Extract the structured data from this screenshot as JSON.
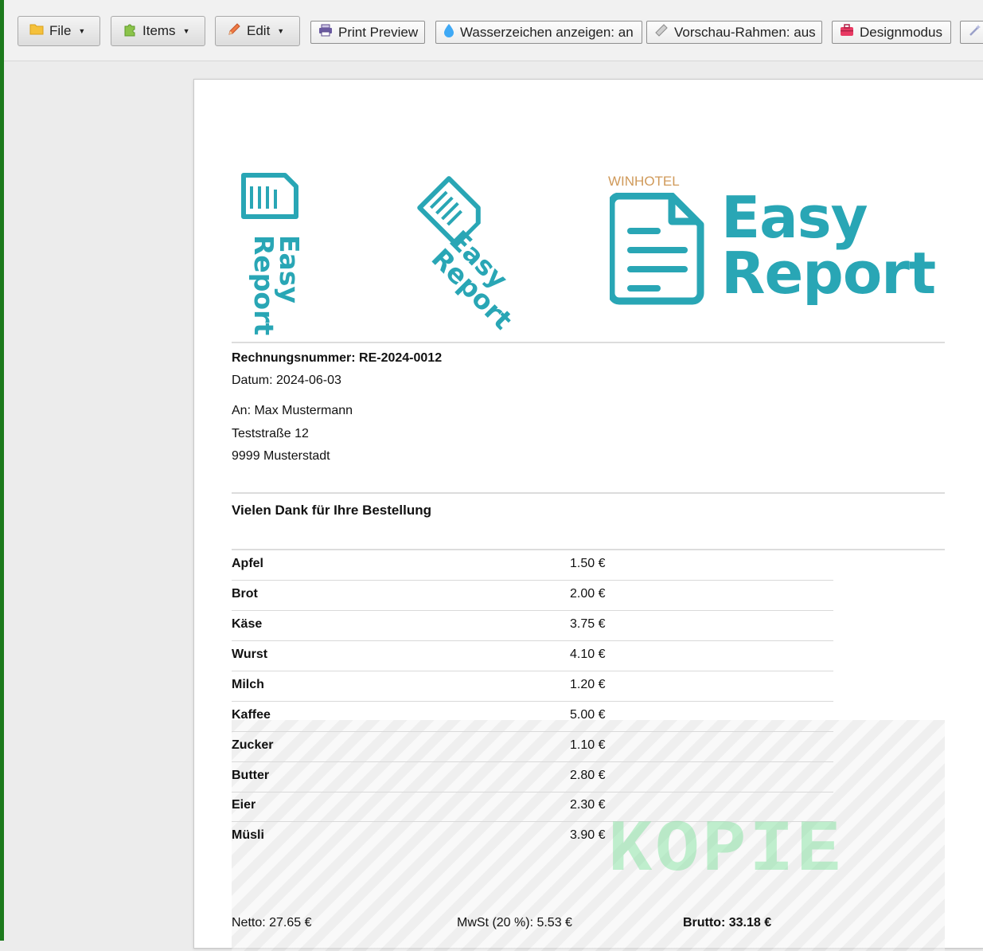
{
  "toolbar": {
    "file_label": "File",
    "items_label": "Items",
    "edit_label": "Edit",
    "print_preview_label": "Print Preview",
    "watermark_toggle_label": "Wasserzeichen anzeigen: an",
    "preview_frame_label": "Vorschau-Rahmen: aus",
    "design_mode_label": "Designmodus"
  },
  "logos": {
    "brand_small": "WINHOTEL",
    "brand_line1": "Easy",
    "brand_line2": "Report",
    "color": "#29a6b5",
    "brand_small_color": "#d09a5a"
  },
  "invoice": {
    "number_label": "Rechnungsnummer: RE-2024-0012",
    "date_label": "Datum: 2024-06-03",
    "to_line": "An: Max Mustermann",
    "street": "Teststraße 12",
    "city": "9999 Musterstadt",
    "thanks": "Vielen Dank für Ihre Bestellung",
    "items": [
      {
        "name": "Apfel",
        "price": "1.50 €"
      },
      {
        "name": "Brot",
        "price": "2.00 €"
      },
      {
        "name": "Käse",
        "price": "3.75 €"
      },
      {
        "name": "Wurst",
        "price": "4.10 €"
      },
      {
        "name": "Milch",
        "price": "1.20 €"
      },
      {
        "name": "Kaffee",
        "price": "5.00 €"
      },
      {
        "name": "Zucker",
        "price": "1.10 €"
      },
      {
        "name": "Butter",
        "price": "2.80 €"
      },
      {
        "name": "Eier",
        "price": "2.30 €"
      },
      {
        "name": "Müsli",
        "price": "3.90 €"
      }
    ],
    "netto": "Netto: 27.65 €",
    "mwst": "MwSt (20 %): 5.53 €",
    "brutto": "Brutto: 33.18 €"
  },
  "watermark": {
    "text": "KOPIE",
    "color": "#78e196"
  }
}
